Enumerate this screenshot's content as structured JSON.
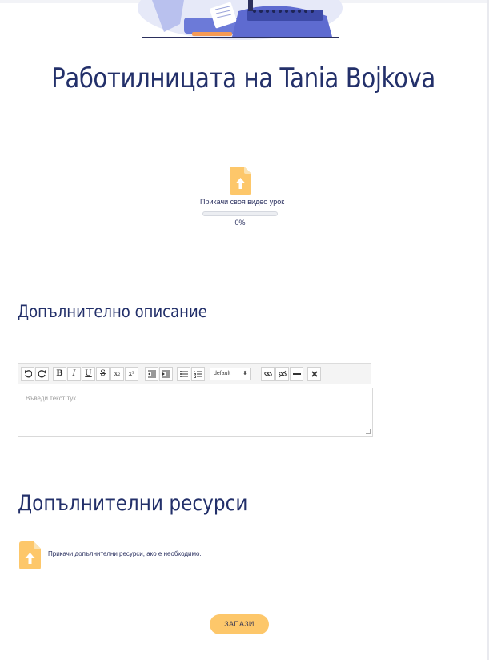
{
  "colors": {
    "accent": "#fdc76a",
    "heading": "#23306a"
  },
  "page": {
    "title": "Работилницата на Tania Bojkova"
  },
  "video_upload": {
    "label": "Прикачи своя видео урок",
    "progress_text": "0%",
    "progress_fraction": 0
  },
  "description": {
    "heading": "Допълнително описание",
    "placeholder": "Въведи текст тук...",
    "font_select": "default",
    "toolbar": [
      "undo-icon",
      "redo-icon",
      "bold",
      "italic",
      "underline",
      "strikethrough",
      "subscript",
      "superscript",
      "outdent-icon",
      "indent-icon",
      "bullet-list-icon",
      "numbered-list-icon",
      "font-select",
      "link-icon",
      "unlink-icon",
      "horizontal-rule-icon",
      "clear-format-icon"
    ],
    "toolbar_labels": {
      "bold": "B",
      "italic": "I",
      "underline": "U",
      "strike": "S",
      "subscript": "x₂",
      "superscript": "x²"
    }
  },
  "resources": {
    "heading": "Допълнителни ресурси",
    "upload_label": "Прикачи допълнителни ресурси, ако е необходимо."
  },
  "actions": {
    "save_label": "ЗАПАЗИ"
  }
}
